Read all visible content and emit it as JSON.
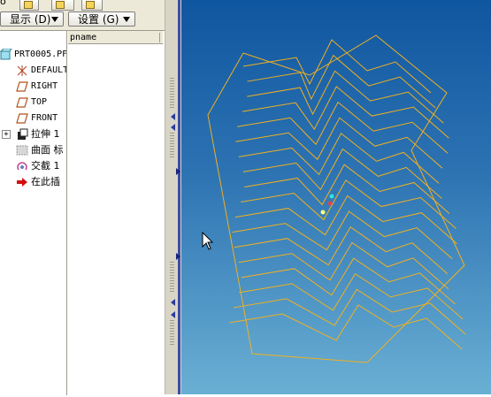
{
  "top_tabs": {
    "glyph": "o"
  },
  "toolbar": {
    "display_label": "显示 (D)",
    "settings_label": "设置 (G)"
  },
  "tree": {
    "column_header": "pname",
    "items": [
      {
        "label": "PRT0005.PF",
        "icon": "part-icon"
      },
      {
        "label": "DEFAULT",
        "icon": "csys-icon"
      },
      {
        "label": "RIGHT",
        "icon": "datum-plane-icon"
      },
      {
        "label": "TOP",
        "icon": "datum-plane-icon"
      },
      {
        "label": "FRONT",
        "icon": "datum-plane-icon"
      },
      {
        "label": "拉伸 1",
        "icon": "extrude-icon"
      },
      {
        "label": "曲面 标",
        "icon": "surface-icon"
      },
      {
        "label": "交截 1",
        "icon": "intersect-icon"
      },
      {
        "label": "在此插",
        "icon": "insert-arrow-icon"
      }
    ]
  },
  "colors": {
    "curve": "#f0b020",
    "viewport_top": "#0f56a0",
    "viewport_bottom": "#6ab0d4"
  }
}
